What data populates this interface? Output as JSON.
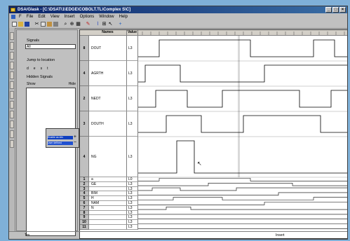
{
  "window": {
    "title": "DSA/Glask - [C:\\DSAT\\1\\EDGE\\COBOLT.TL\\Complex S\\C]"
  },
  "menu": {
    "items": [
      "F",
      "File",
      "Edit",
      "View",
      "Insert",
      "Options",
      "Window",
      "Help"
    ]
  },
  "left_panel": {
    "signals_label": "Signals",
    "signals_value": "All",
    "radios_label": "Jump to location",
    "radios": [
      "d",
      "e",
      "s",
      "t"
    ],
    "hidden_label": "Hidden Signals",
    "col_show": "Show",
    "col_hide": "Hide",
    "popup_rows": [
      "",
      "Enable as dev",
      "User defined"
    ]
  },
  "grid": {
    "header_names": "Names",
    "header_value": "Value",
    "large_rows": [
      {
        "index": "8",
        "name": "DOUT",
        "value": "L3"
      },
      {
        "index": "4",
        "name": "AGRTH",
        "value": "L3"
      },
      {
        "index": "2",
        "name": "NEDT",
        "value": "L3"
      },
      {
        "index": "3",
        "name": "DOUTH",
        "value": "L3"
      },
      {
        "index": "4",
        "name": "NG",
        "value": "L3"
      }
    ],
    "small_rows": [
      {
        "index": "1",
        "name": "a",
        "value": "L0"
      },
      {
        "index": "2",
        "name": "GE",
        "value": "L3"
      },
      {
        "index": "3",
        "name": "",
        "value": "L3"
      },
      {
        "index": "4",
        "name": "BIM",
        "value": "L3"
      },
      {
        "index": "5",
        "name": "H",
        "value": "L3"
      },
      {
        "index": "6",
        "name": "NAM",
        "value": "L3"
      },
      {
        "index": "7",
        "name": "N",
        "value": "L3"
      },
      {
        "index": "8",
        "name": "",
        "value": "L3"
      },
      {
        "index": "9",
        "name": "",
        "value": "L3"
      },
      {
        "index": "10",
        "name": "",
        "value": "L3"
      },
      {
        "index": "11",
        "name": "",
        "value": "L3"
      }
    ]
  },
  "status": {
    "left": "Tm",
    "right": "Insert"
  },
  "colors": {
    "title_start": "#0a246a",
    "title_end": "#3a6ea5",
    "desktop": "#7fb0d8",
    "wave": "#000000"
  }
}
